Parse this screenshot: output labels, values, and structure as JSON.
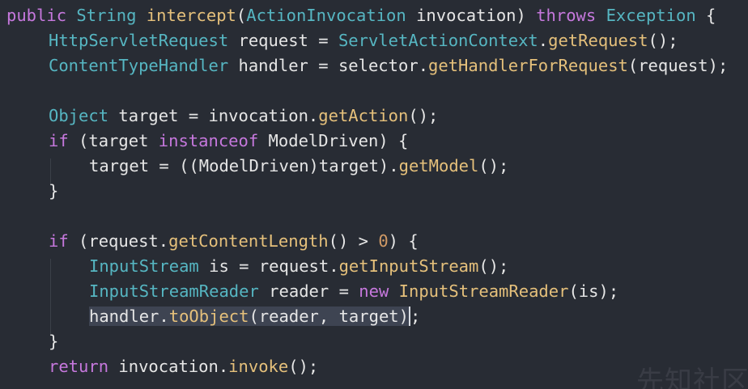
{
  "editor": {
    "theme": {
      "background": "#282c34",
      "keyword": "#c678dd",
      "type": "#56b6c2",
      "method": "#e5c07b",
      "plain": "#e6e6e6",
      "number": "#d19a66",
      "selection": "#3e4452"
    },
    "lines": [
      {
        "tokens": [
          {
            "t": "public ",
            "c": "kw"
          },
          {
            "t": "String ",
            "c": "ty"
          },
          {
            "t": "intercept",
            "c": "fn"
          },
          {
            "t": "(",
            "c": "pl"
          },
          {
            "t": "ActionInvocation ",
            "c": "ty"
          },
          {
            "t": "invocation",
            "c": "pl"
          },
          {
            "t": ") ",
            "c": "pl"
          },
          {
            "t": "throws ",
            "c": "kw"
          },
          {
            "t": "Exception ",
            "c": "ty"
          },
          {
            "t": "{",
            "c": "pl"
          }
        ]
      },
      {
        "tokens": [
          {
            "t": "HttpServletRequest ",
            "c": "ty"
          },
          {
            "t": "request ",
            "c": "pl"
          },
          {
            "t": "= ",
            "c": "pl"
          },
          {
            "t": "ServletActionContext",
            "c": "ty"
          },
          {
            "t": ".",
            "c": "pl"
          },
          {
            "t": "getRequest",
            "c": "fn"
          },
          {
            "t": "();",
            "c": "pl"
          }
        ]
      },
      {
        "tokens": [
          {
            "t": "ContentTypeHandler ",
            "c": "ty"
          },
          {
            "t": "handler ",
            "c": "pl"
          },
          {
            "t": "= ",
            "c": "pl"
          },
          {
            "t": "selector",
            "c": "pl"
          },
          {
            "t": ".",
            "c": "pl"
          },
          {
            "t": "getHandlerForRequest",
            "c": "fn"
          },
          {
            "t": "(request);",
            "c": "pl"
          }
        ]
      },
      {
        "tokens": []
      },
      {
        "tokens": [
          {
            "t": "Object ",
            "c": "ty"
          },
          {
            "t": "target ",
            "c": "pl"
          },
          {
            "t": "= ",
            "c": "pl"
          },
          {
            "t": "invocation",
            "c": "pl"
          },
          {
            "t": ".",
            "c": "pl"
          },
          {
            "t": "getAction",
            "c": "fn"
          },
          {
            "t": "();",
            "c": "pl"
          }
        ]
      },
      {
        "tokens": [
          {
            "t": "if ",
            "c": "kw"
          },
          {
            "t": "(target ",
            "c": "pl"
          },
          {
            "t": "instanceof ",
            "c": "kw"
          },
          {
            "t": "ModelDriven",
            "c": "pl"
          },
          {
            "t": ") {",
            "c": "pl"
          }
        ]
      },
      {
        "tokens": [
          {
            "t": "target ",
            "c": "pl"
          },
          {
            "t": "= ",
            "c": "pl"
          },
          {
            "t": "((ModelDriven)target).",
            "c": "pl"
          },
          {
            "t": "getModel",
            "c": "fn"
          },
          {
            "t": "();",
            "c": "pl"
          }
        ]
      },
      {
        "tokens": [
          {
            "t": "}",
            "c": "pl"
          }
        ]
      },
      {
        "tokens": []
      },
      {
        "tokens": [
          {
            "t": "if ",
            "c": "kw"
          },
          {
            "t": "(request.",
            "c": "pl"
          },
          {
            "t": "getContentLength",
            "c": "fn"
          },
          {
            "t": "() > ",
            "c": "pl"
          },
          {
            "t": "0",
            "c": "num"
          },
          {
            "t": ") {",
            "c": "pl"
          }
        ]
      },
      {
        "tokens": [
          {
            "t": "InputStream ",
            "c": "ty"
          },
          {
            "t": "is ",
            "c": "pl"
          },
          {
            "t": "= ",
            "c": "pl"
          },
          {
            "t": "request.",
            "c": "pl"
          },
          {
            "t": "getInputStream",
            "c": "fn"
          },
          {
            "t": "();",
            "c": "pl"
          }
        ]
      },
      {
        "tokens": [
          {
            "t": "InputStreamReader ",
            "c": "ty"
          },
          {
            "t": "reader ",
            "c": "pl"
          },
          {
            "t": "= ",
            "c": "pl"
          },
          {
            "t": "new ",
            "c": "kw"
          },
          {
            "t": "InputStreamReader",
            "c": "fn"
          },
          {
            "t": "(is);",
            "c": "pl"
          }
        ]
      },
      {
        "highlight": "handler.toObject(reader, target)",
        "tokens": [
          {
            "t": "handler",
            "c": "pl",
            "h": true
          },
          {
            "t": ".",
            "c": "pl",
            "h": true
          },
          {
            "t": "toObject",
            "c": "fn",
            "h": true
          },
          {
            "t": "(reader, target)",
            "c": "pl",
            "h": true
          },
          {
            "t": ";",
            "c": "pl"
          }
        ]
      },
      {
        "tokens": [
          {
            "t": "}",
            "c": "pl"
          }
        ]
      },
      {
        "tokens": [
          {
            "t": "return ",
            "c": "kw"
          },
          {
            "t": "invocation",
            "c": "pl"
          },
          {
            "t": ".",
            "c": "pl"
          },
          {
            "t": "invoke",
            "c": "fn"
          },
          {
            "t": "();",
            "c": "pl"
          }
        ]
      }
    ]
  },
  "watermark": "先知社区"
}
